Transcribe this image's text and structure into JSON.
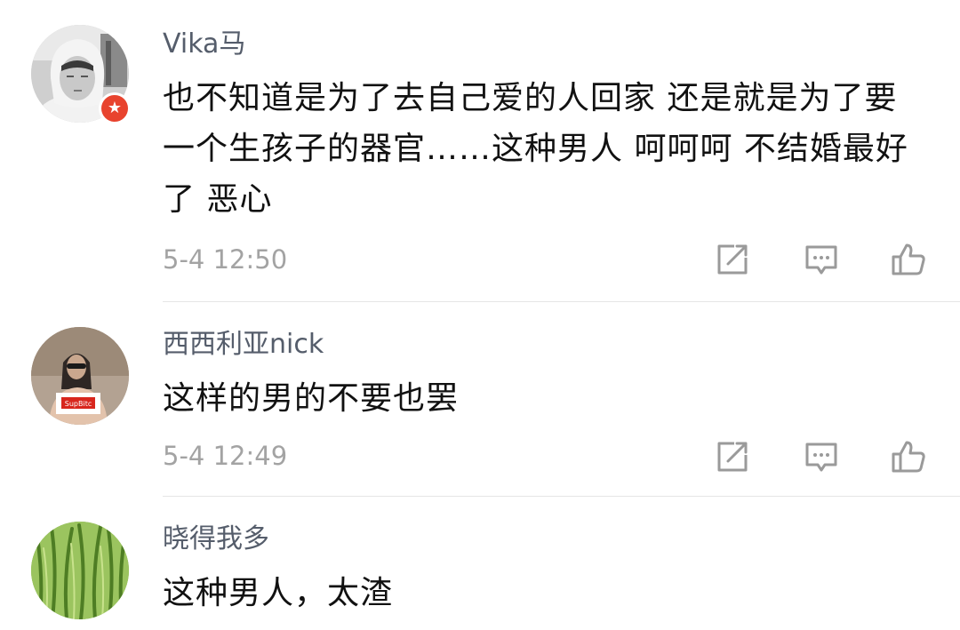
{
  "comments": [
    {
      "username": "Vika马",
      "verified_badge": true,
      "badge_color": "#e8432e",
      "avatar_icon": "avatar-grayscale-person",
      "text": "也不知道是为了去自己爱的人回家 还是就是为了要一个生孩子的器官……这种男人 呵呵呵 不结婚最好了 恶心",
      "timestamp": "5-4 12:50",
      "actions": [
        "repost-icon",
        "reply-icon",
        "like-icon"
      ]
    },
    {
      "username": "西西利亚nick",
      "verified_badge": false,
      "avatar_icon": "avatar-person-photo",
      "avatar_shirt_text": "SupBitc",
      "text": "这样的男的不要也罢",
      "timestamp": "5-4 12:49",
      "actions": [
        "repost-icon",
        "reply-icon",
        "like-icon"
      ]
    },
    {
      "username": "晓得我多",
      "verified_badge": false,
      "avatar_icon": "avatar-green-grass",
      "text": "这种男人，太渣"
    }
  ],
  "colors": {
    "username": "#555d6b",
    "text": "#111111",
    "timestamp": "#a3a3a3",
    "icon_stroke": "#9a9a9a",
    "divider": "#e6e6e6"
  }
}
